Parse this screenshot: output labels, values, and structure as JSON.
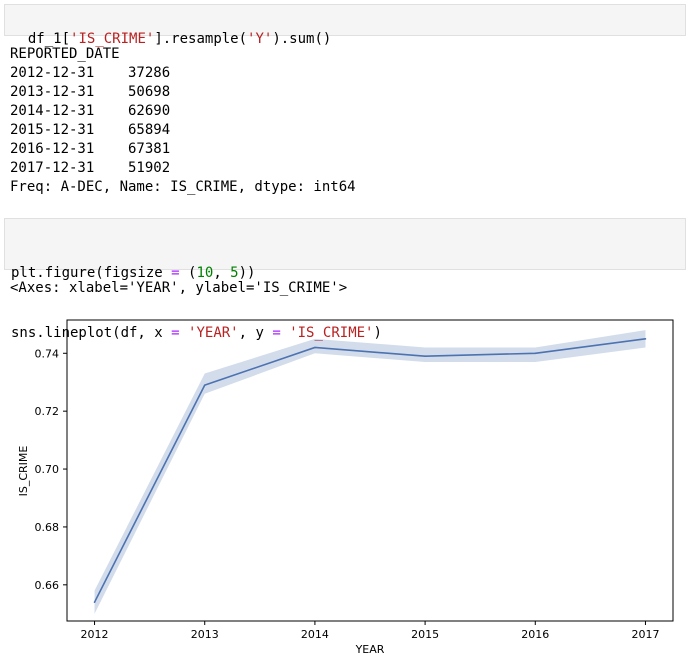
{
  "cell1": {
    "code": [
      {
        "t": "df_1[",
        "c": ""
      },
      {
        "t": "'IS_CRIME'",
        "c": "str"
      },
      {
        "t": "].resample(",
        "c": ""
      },
      {
        "t": "'Y'",
        "c": "str"
      },
      {
        "t": ").sum()",
        "c": ""
      }
    ]
  },
  "output1": {
    "lines": [
      "REPORTED_DATE",
      "2012-12-31    37286",
      "2013-12-31    50698",
      "2014-12-31    62690",
      "2015-12-31    65894",
      "2016-12-31    67381",
      "2017-12-31    51902",
      "Freq: A-DEC, Name: IS_CRIME, dtype: int64"
    ]
  },
  "cell2": {
    "line1": [
      {
        "t": "plt.figure(figsize ",
        "c": ""
      },
      {
        "t": "=",
        "c": "op"
      },
      {
        "t": " (",
        "c": ""
      },
      {
        "t": "10",
        "c": "num"
      },
      {
        "t": ", ",
        "c": ""
      },
      {
        "t": "5",
        "c": "num"
      },
      {
        "t": "))",
        "c": ""
      }
    ],
    "line2": [
      {
        "t": "sns.lineplot(df, x ",
        "c": ""
      },
      {
        "t": "=",
        "c": "op"
      },
      {
        "t": " ",
        "c": ""
      },
      {
        "t": "'YEAR'",
        "c": "str"
      },
      {
        "t": ", y ",
        "c": ""
      },
      {
        "t": "=",
        "c": "op"
      },
      {
        "t": " ",
        "c": ""
      },
      {
        "t": "'IS_CRIME'",
        "c": "str"
      },
      {
        "t": ")",
        "c": ""
      }
    ]
  },
  "output2": {
    "repr": "<Axes: xlabel='YEAR', ylabel='IS_CRIME'>"
  },
  "colors": {
    "line": "#4c72b0",
    "band": "#4c72b0"
  },
  "chart_data": {
    "type": "line",
    "title": "",
    "xlabel": "YEAR",
    "ylabel": "IS_CRIME",
    "x": [
      2012,
      2013,
      2014,
      2015,
      2016,
      2017
    ],
    "series": [
      {
        "values": [
          0.654,
          0.729,
          0.742,
          0.739,
          0.74,
          0.745
        ],
        "ci_low": [
          0.65,
          0.726,
          0.74,
          0.737,
          0.737,
          0.742
        ],
        "ci_high": [
          0.658,
          0.733,
          0.745,
          0.742,
          0.742,
          0.748
        ]
      }
    ],
    "xticks": [
      2012,
      2013,
      2014,
      2015,
      2016,
      2017
    ],
    "yticks": [
      0.66,
      0.68,
      0.7,
      0.72,
      0.74
    ],
    "ytick_labels": [
      "0.66",
      "0.68",
      "0.70",
      "0.72",
      "0.74"
    ],
    "xlim": [
      2011.75,
      2017.25
    ],
    "ylim": [
      0.6475,
      0.7515
    ],
    "grid": false,
    "legend": "none"
  }
}
